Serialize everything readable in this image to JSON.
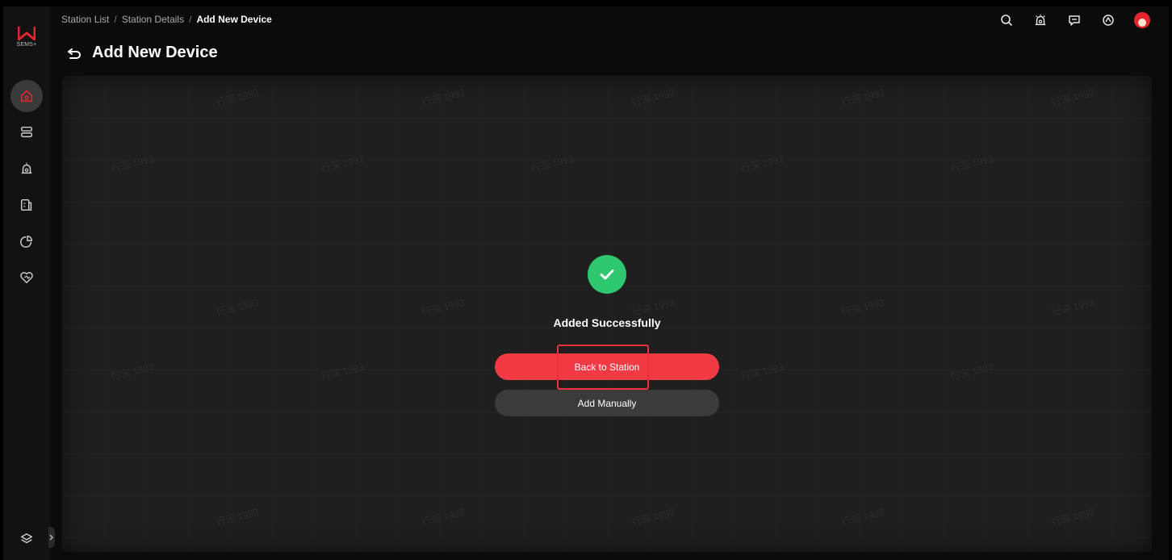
{
  "app": {
    "logo_text": "W",
    "logo_sub": "SEMS+",
    "brand_color": "#e3262e"
  },
  "breadcrumb": {
    "items": [
      "Station List",
      "Station Details",
      "Add New Device"
    ],
    "separator": "/"
  },
  "page": {
    "title": "Add New Device"
  },
  "header_icons": [
    "search-icon",
    "alarm-icon",
    "message-icon",
    "settings-icon",
    "avatar"
  ],
  "sidebar": {
    "items": [
      {
        "icon": "home-icon",
        "active": true
      },
      {
        "icon": "device-list-icon",
        "active": false
      },
      {
        "icon": "alarm-icon",
        "active": false
      },
      {
        "icon": "report-icon",
        "active": false
      },
      {
        "icon": "analytics-icon",
        "active": false
      },
      {
        "icon": "service-icon",
        "active": false
      }
    ],
    "bottom_icon": "layers-icon"
  },
  "result": {
    "status_text": "Added Successfully",
    "status_color": "#2dc76d",
    "primary_button": "Back to Station",
    "secondary_button": "Add Manually"
  },
  "watermark_text": "行深 1993"
}
